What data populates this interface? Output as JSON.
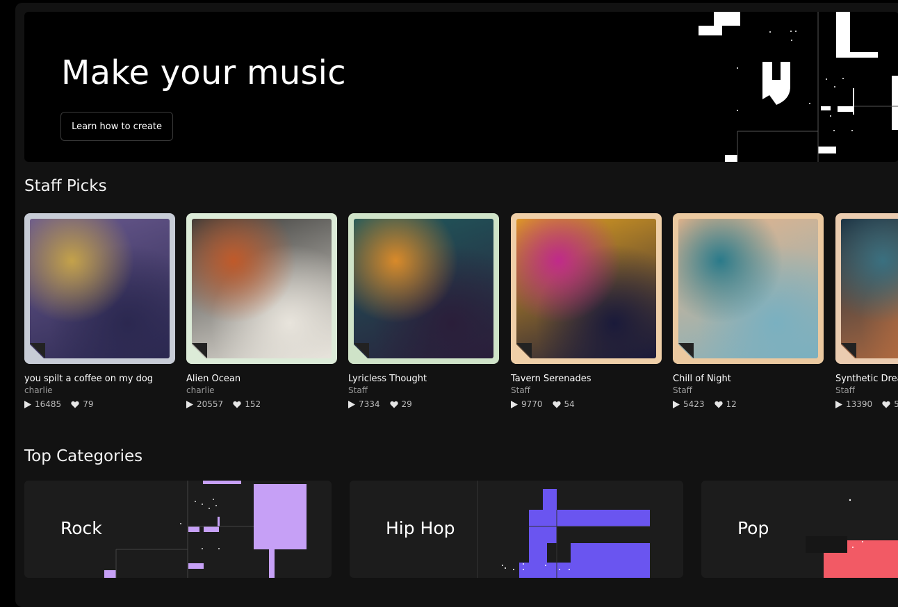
{
  "hero": {
    "title": "Make your music",
    "button_label": "Learn how to create"
  },
  "staff_picks": {
    "heading": "Staff Picks",
    "items": [
      {
        "title": "you spilt a coffee on my dog",
        "author": "charlie",
        "plays": "16485",
        "likes": "79",
        "frame_color": "#c7ccd6",
        "art_colors": [
          "#6a5a8f",
          "#c4a24a",
          "#2b2850"
        ]
      },
      {
        "title": "Alien Ocean",
        "author": "charlie",
        "plays": "20557",
        "likes": "152",
        "frame_color": "#dcebd8",
        "art_colors": [
          "#3a3a38",
          "#c05a2a",
          "#e8e4dc"
        ]
      },
      {
        "title": "Lyricless Thought",
        "author": "Staff",
        "plays": "7334",
        "likes": "29",
        "frame_color": "#cfe3c8",
        "art_colors": [
          "#1f5a5c",
          "#d98a2a",
          "#2a1e3a"
        ]
      },
      {
        "title": "Tavern Serenades",
        "author": "Staff",
        "plays": "9770",
        "likes": "54",
        "frame_color": "#efcfa8",
        "art_colors": [
          "#e0a020",
          "#c02a8a",
          "#1a1a3a"
        ]
      },
      {
        "title": "Chill of Night",
        "author": "Staff",
        "plays": "5423",
        "likes": "12",
        "frame_color": "#ebc9a0",
        "art_colors": [
          "#e8b48a",
          "#2a7a8a",
          "#7ab0c0"
        ]
      },
      {
        "title": "Synthetic Drea",
        "author": "Staff",
        "plays": "13390",
        "likes": "5",
        "frame_color": "#ebccb0",
        "art_colors": [
          "#1a3040",
          "#3a7080",
          "#c07040"
        ]
      }
    ]
  },
  "top_categories": {
    "heading": "Top Categories",
    "items": [
      {
        "label": "Rock",
        "accent": "#c6a0f6"
      },
      {
        "label": "Hip Hop",
        "accent": "#6a55f0"
      },
      {
        "label": "Pop",
        "accent": "#f25a65"
      }
    ]
  },
  "icons": {
    "play": "play-icon",
    "like": "heart-icon",
    "corner": "logo-corner-icon"
  }
}
